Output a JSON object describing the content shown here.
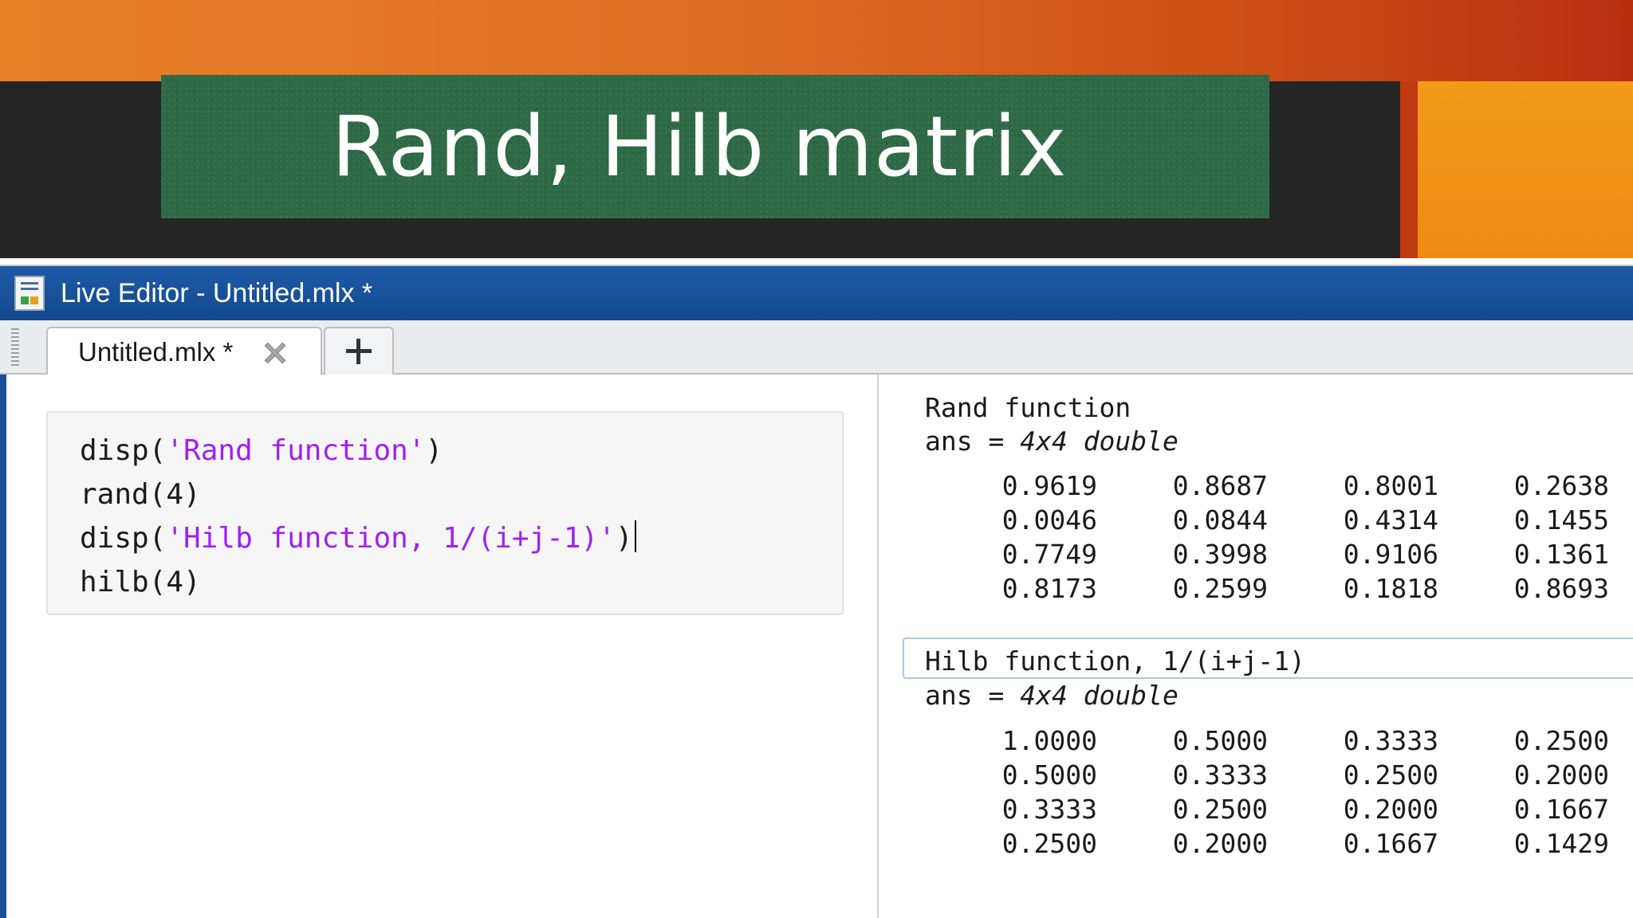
{
  "slide": {
    "title": "Rand, Hilb matrix",
    "colors": {
      "top_bar": "#e8802a",
      "dark_band": "#252525",
      "board": "#2e6a45",
      "accent_block": "#f29a1a"
    }
  },
  "editor": {
    "window_title": "Live Editor - Untitled.mlx *",
    "tab_label": "Untitled.mlx *",
    "icons": {
      "window": "live-editor-icon",
      "close": "close-icon",
      "add": "plus-icon"
    },
    "code_lines": [
      {
        "pre": "disp(",
        "str": "'Rand function'",
        "post": ")"
      },
      {
        "pre": "rand(4)",
        "str": "",
        "post": ""
      },
      {
        "pre": "disp(",
        "str": "'Hilb function, 1/(i+j-1)'",
        "post": ")"
      },
      {
        "pre": "hilb(4)",
        "str": "",
        "post": ""
      }
    ]
  },
  "output": {
    "rand_label": "Rand function",
    "ans_prefix": "ans = ",
    "ans_size": "4x4 double",
    "rand_matrix": [
      [
        "0.9619",
        "0.8687",
        "0.8001",
        "0.2638"
      ],
      [
        "0.0046",
        "0.0844",
        "0.4314",
        "0.1455"
      ],
      [
        "0.7749",
        "0.3998",
        "0.9106",
        "0.1361"
      ],
      [
        "0.8173",
        "0.2599",
        "0.1818",
        "0.8693"
      ]
    ],
    "hilb_label": "Hilb function, 1/(i+j-1)",
    "hilb_matrix": [
      [
        "1.0000",
        "0.5000",
        "0.3333",
        "0.2500"
      ],
      [
        "0.5000",
        "0.3333",
        "0.2500",
        "0.2000"
      ],
      [
        "0.3333",
        "0.2500",
        "0.2000",
        "0.1667"
      ],
      [
        "0.2500",
        "0.2000",
        "0.1667",
        "0.1429"
      ]
    ]
  }
}
